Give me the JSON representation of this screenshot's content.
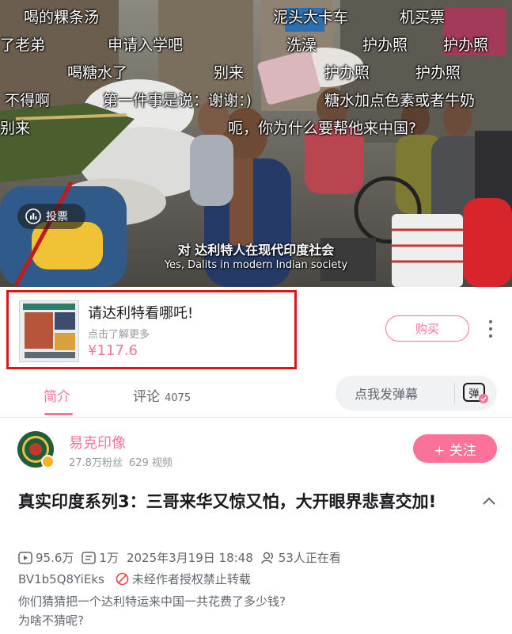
{
  "video": {
    "danmaku": [
      "喝的粿条汤",
      "泥头大卡车",
      "机买票",
      "了老弟",
      "申请入学吧",
      "洗澡",
      "护办照",
      "护办照",
      "喝糖水了",
      "别来",
      "护办照",
      "护办照",
      "不得啊",
      "第一件事是说：谢谢：)",
      "糖水加点色素或者牛奶",
      "别来",
      "呃，你为什么要帮他来中国?"
    ],
    "subtitle_cn": "对 达利特人在现代印度社会",
    "subtitle_en": "Yes, Dalits in modern Indian society",
    "vote_label": "投票"
  },
  "product": {
    "title": "请达利特看哪吒!",
    "subtitle": "点击了解更多",
    "price": "¥117.6",
    "buy_label": "购买"
  },
  "tabs": {
    "intro_label": "简介",
    "comments_label": "评论",
    "comments_count": "4075",
    "danmu_placeholder": "点我发弹幕",
    "danmu_icon_text": "弹"
  },
  "uploader": {
    "name": "易克印像",
    "followers": "27.8万粉丝",
    "videos": "629 视频",
    "follow_label": "+ 关注"
  },
  "video_info": {
    "title": "真实印度系列3：三哥来华又惊又怕，大开眼界悲喜交加!",
    "views": "95.6万",
    "danmaku_count": "1万",
    "publish_time": "2025年3月19日 18:48",
    "watching": "53人正在看",
    "bvid": "BV1b5Q8YiEks",
    "no_repost": "未经作者授权禁止转载",
    "description_lines": [
      "你们猜猜把一个达利特运来中国一共花费了多少钱?",
      "为啥不猜呢?"
    ]
  },
  "colors": {
    "accent": "#fb7299",
    "highlight_box": "#e01414",
    "text_primary": "#18191c",
    "text_secondary": "#61666d",
    "text_muted": "#9499a0"
  }
}
